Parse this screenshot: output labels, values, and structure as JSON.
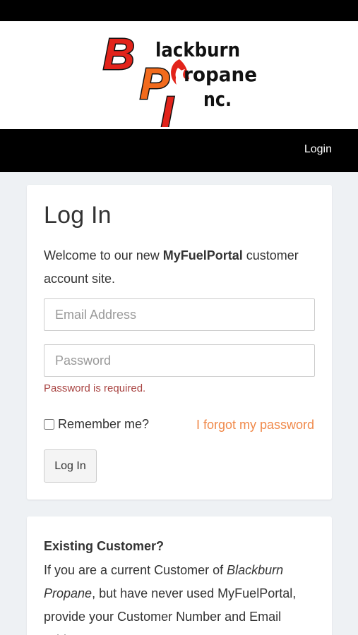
{
  "header": {
    "logo_text": "Blackburn Propane Inc.",
    "logo_initials": [
      "B",
      "P",
      "I"
    ],
    "logo_words": [
      "lackburn",
      "ropane",
      "nc."
    ]
  },
  "nav": {
    "login_label": "Login"
  },
  "login_card": {
    "title": "Log In",
    "welcome_prefix": "Welcome to our new ",
    "welcome_brand": "MyFuelPortal",
    "welcome_suffix": " customer account site.",
    "email_placeholder": "Email Address",
    "email_value": "",
    "password_placeholder": "Password",
    "password_value": "",
    "password_error": "Password is required.",
    "remember_label": "Remember me?",
    "remember_checked": false,
    "forgot_label": "I forgot my password",
    "submit_label": "Log In"
  },
  "info_card": {
    "heading": "Existing Customer?",
    "text_1": "If you are a current Customer of ",
    "text_company": "Blackburn Propane",
    "text_2": ", but have never used MyFuelPortal, provide your Customer Number and Email Address"
  },
  "colors": {
    "accent_orange": "#f0894a",
    "error_red": "#a94442",
    "logo_red": "#e2231a",
    "logo_orange": "#f26b1d",
    "nav_bg": "#000000",
    "page_bg": "#eef1f4"
  }
}
